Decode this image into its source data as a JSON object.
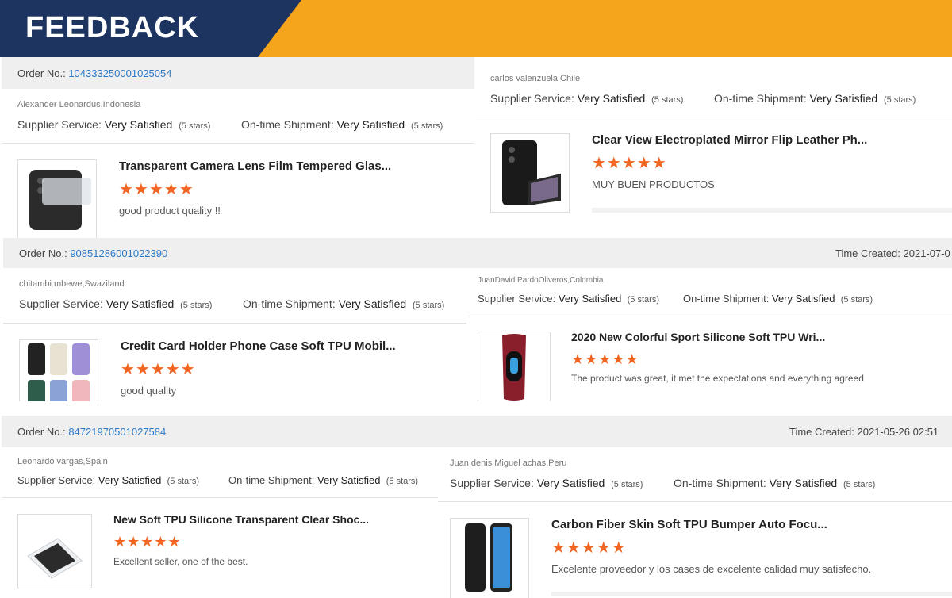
{
  "banner": {
    "title": "FEEDBACK"
  },
  "labels": {
    "order_no": "Order No.:",
    "time_created": "Time Created:",
    "supplier_service": "Supplier Service:",
    "ontime_shipment": "On-time Shipment:",
    "very_satisfied": "Very Satisfied",
    "five_stars": "(5 stars)",
    "star_glyphs": "★★★★★"
  },
  "orders": [
    {
      "number": "104333250001025054",
      "time_created": ""
    },
    {
      "number": "90851286001022390",
      "time_created": "2021-07-0"
    },
    {
      "number": "84721970501027584",
      "time_created": "2021-05-26 02:51"
    }
  ],
  "reviews": [
    {
      "buyer": "Alexander Leonardus,Indonesia",
      "product": "Transparent Camera Lens Film Tempered Glas...",
      "comment": "good product quality !!",
      "rating": 5
    },
    {
      "buyer": "carlos valenzuela,Chile",
      "product": "Clear View Electroplated Mirror Flip Leather Ph...",
      "comment": "MUY BUEN PRODUCTOS",
      "rating": 5
    },
    {
      "buyer": "chitambi mbewe,Swaziland",
      "product": "Credit Card Holder Phone Case Soft TPU Mobil...",
      "comment": "good quality",
      "rating": 5
    },
    {
      "buyer": "JuanDavid PardoOliveros,Colombia",
      "product": "2020 New Colorful Sport Silicone Soft TPU Wri...",
      "comment": "The product was great, it met the expectations and everything agreed",
      "rating": 5
    },
    {
      "buyer": "Leonardo vargas,Spain",
      "product": "New Soft TPU Silicone Transparent Clear Shoc...",
      "comment": "Excellent seller, one of the best.",
      "rating": 5
    },
    {
      "buyer": "Juan denis Miguel achas,Peru",
      "product": "Carbon Fiber Skin Soft TPU Bumper Auto Focu...",
      "comment": "Excelente proveedor y los cases de excelente calidad muy satisfecho.",
      "rating": 5
    }
  ],
  "colors": {
    "accent_orange": "#f5a51c",
    "banner_navy": "#1d3461",
    "star": "#f26522",
    "link": "#2b78c5"
  }
}
